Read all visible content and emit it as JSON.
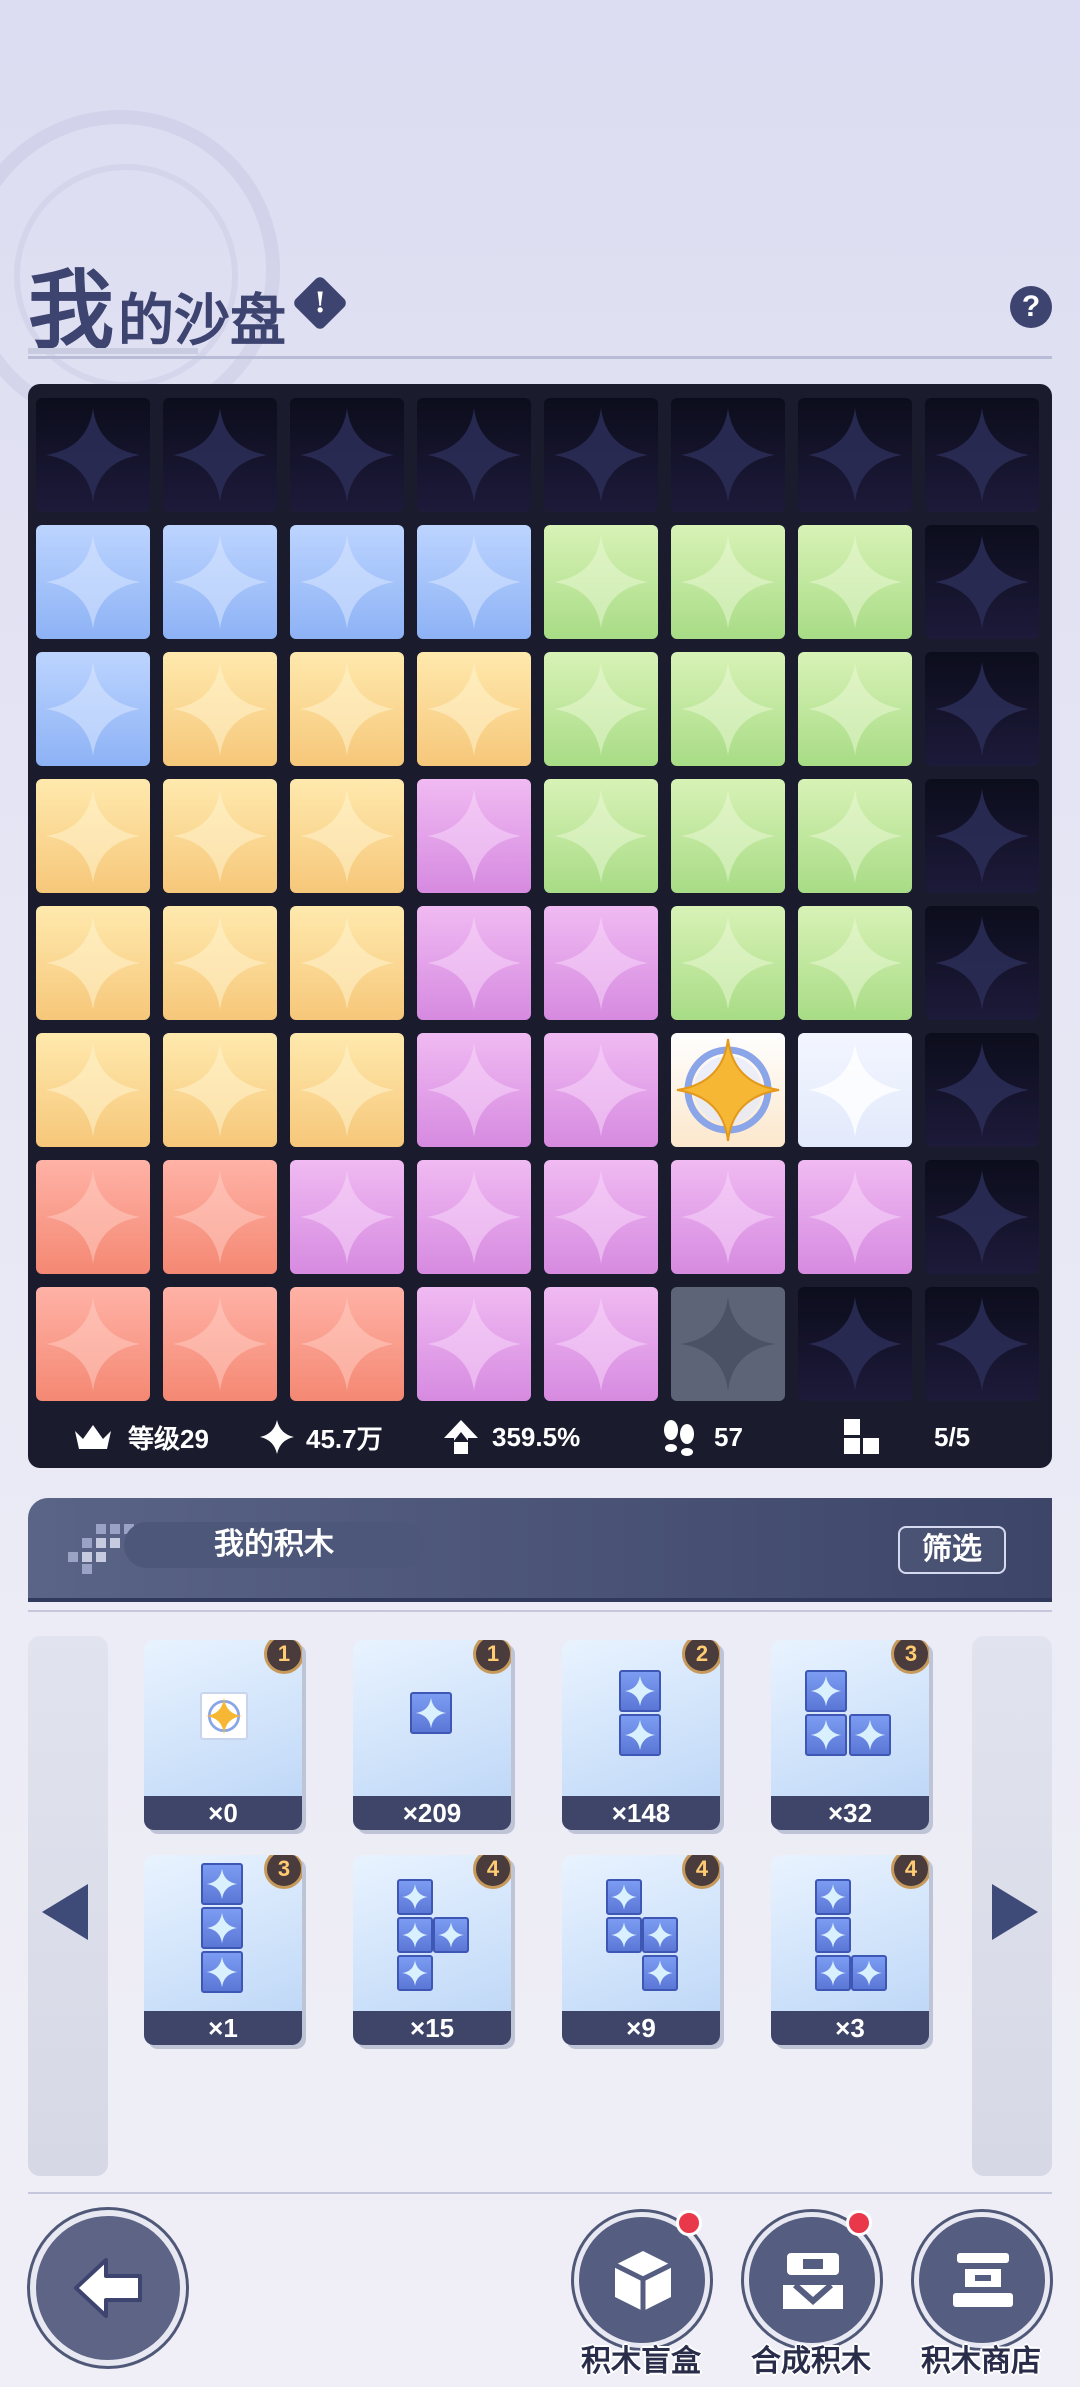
{
  "header": {
    "title_big": "我",
    "title_rest": "的沙盘"
  },
  "board": {
    "rows": [
      [
        "dark",
        "dark",
        "dark",
        "dark",
        "dark",
        "dark",
        "dark",
        "dark"
      ],
      [
        "blue",
        "blue",
        "blue",
        "blue",
        "green",
        "green",
        "green",
        "dark"
      ],
      [
        "blue",
        "yellow",
        "yellow",
        "yellow",
        "green",
        "green",
        "green",
        "dark"
      ],
      [
        "yellow",
        "yellow",
        "yellow",
        "purple",
        "green",
        "green",
        "green",
        "dark"
      ],
      [
        "yellow",
        "yellow",
        "yellow",
        "purple",
        "purple",
        "green",
        "green",
        "dark"
      ],
      [
        "yellow",
        "yellow",
        "yellow",
        "purple",
        "purple",
        "special",
        "white",
        "dark"
      ],
      [
        "red",
        "red",
        "purple",
        "purple",
        "purple",
        "purple",
        "purple",
        "dark"
      ],
      [
        "red",
        "red",
        "red",
        "purple",
        "purple",
        "gray",
        "dark",
        "dark"
      ]
    ]
  },
  "stats": {
    "level": "等级29",
    "points": "45.7万",
    "boost": "359.5%",
    "steps": "57",
    "blocks": "5/5"
  },
  "blocks_bar": {
    "title": "我的积木",
    "filter_label": "筛选"
  },
  "inventory": [
    {
      "count": "×0",
      "badge": "1",
      "shape": "special1"
    },
    {
      "count": "×209",
      "badge": "1",
      "shape": "one"
    },
    {
      "count": "×148",
      "badge": "2",
      "shape": "vert2"
    },
    {
      "count": "×32",
      "badge": "3",
      "shape": "L3"
    },
    {
      "count": "×1",
      "badge": "3",
      "shape": "vert3"
    },
    {
      "count": "×15",
      "badge": "4",
      "shape": "T4"
    },
    {
      "count": "×9",
      "badge": "4",
      "shape": "S4"
    },
    {
      "count": "×3",
      "badge": "4",
      "shape": "L4"
    }
  ],
  "nav": {
    "blind_box": "积木盲盒",
    "synthesize": "合成积木",
    "shop": "积木商店"
  },
  "colors": {
    "board_bg": "#1a1c2e",
    "accent_dark": "#3e4470",
    "badge_red": "#e8384a"
  }
}
